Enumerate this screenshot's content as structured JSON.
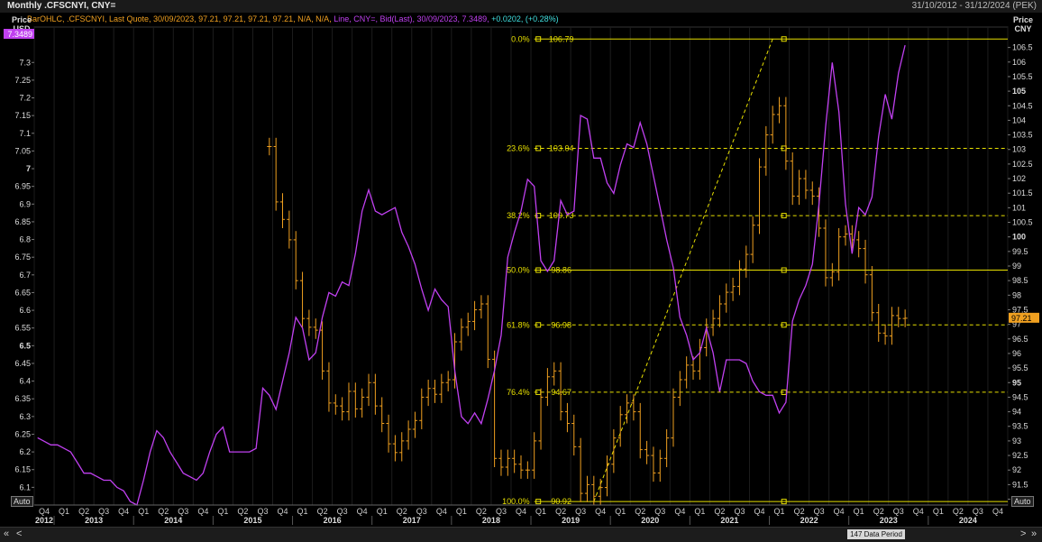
{
  "header": {
    "title": "Monthly .CFSCNYI, CNY=",
    "date_range": "31/10/2012 - 31/12/2024 (PEK)"
  },
  "legend": {
    "bar_series": "BarOHLC, .CFSCNYI, Last Quote, 30/09/2023, 97.21, 97.21, 97.21, 97.21, N/A, N/A,",
    "line_series": "Line, CNY=, Bid(Last), 30/09/2023, 7.3489,",
    "change": "+0.0202, (+0.28%)"
  },
  "left_axis": {
    "title_1": "Price",
    "title_2": "USD",
    "current_value": "7.3489"
  },
  "right_axis": {
    "title_1": "Price",
    "title_2": "CNY",
    "current_value": "97.21"
  },
  "auto_label": "Auto",
  "bottom": {
    "data_period": "147 Data Period",
    "prev_label": "«",
    "scroll_left": "<",
    "scroll_right": ">",
    "next_label": "»"
  },
  "colors": {
    "bars": "#f0a020",
    "line": "#c040f0",
    "fib": "#e8e000",
    "left_badge": "#c040f0",
    "right_badge": "#f0a020"
  },
  "chart_data": {
    "type": "line",
    "x_unit": "month",
    "x_range": [
      "2012-10",
      "2024-12"
    ],
    "left_axis": {
      "ylim": [
        6.05,
        7.4
      ],
      "ticks": [
        "6.1",
        "6.15",
        "6.2",
        "6.25",
        "6.3",
        "6.35",
        "6.4",
        "6.45",
        "6.5",
        "6.55",
        "6.6",
        "6.65",
        "6.7",
        "6.75",
        "6.8",
        "6.85",
        "6.9",
        "6.95",
        "7",
        "7.05",
        "7.1",
        "7.15",
        "7.2",
        "7.25",
        "7.3"
      ],
      "bold_ticks": [
        "6.5",
        "7"
      ]
    },
    "right_axis": {
      "ylim": [
        90.8,
        107.2
      ],
      "ticks": [
        "91",
        "91.5",
        "92",
        "92.5",
        "93",
        "93.5",
        "94",
        "94.5",
        "95",
        "95.5",
        "96",
        "96.5",
        "97",
        "97.5",
        "98",
        "98.5",
        "99",
        "99.5",
        "100",
        "100.5",
        "101",
        "101.5",
        "102",
        "102.5",
        "103",
        "103.5",
        "104",
        "104.5",
        "105",
        "105.5",
        "106",
        "106.5"
      ],
      "bold_ticks": [
        "95",
        "100",
        "105"
      ]
    },
    "x_quarter_labels": [
      "Q4",
      "Q1",
      "Q2",
      "Q3",
      "Q4",
      "Q1",
      "Q2",
      "Q3",
      "Q4",
      "Q1",
      "Q2",
      "Q3",
      "Q4",
      "Q1",
      "Q2",
      "Q3",
      "Q4",
      "Q1",
      "Q2",
      "Q3",
      "Q4",
      "Q1",
      "Q2",
      "Q3",
      "Q4",
      "Q1",
      "Q2",
      "Q3",
      "Q4",
      "Q1",
      "Q2",
      "Q3",
      "Q4",
      "Q1",
      "Q2",
      "Q3",
      "Q4",
      "Q1",
      "Q2",
      "Q3",
      "Q4",
      "Q1",
      "Q2",
      "Q3",
      "Q4",
      "Q1",
      "Q2",
      "Q3",
      "Q4"
    ],
    "x_year_labels": [
      "2012",
      "2013",
      "2014",
      "2015",
      "2016",
      "2017",
      "2018",
      "2019",
      "2020",
      "2021",
      "2022",
      "2023",
      "2024"
    ],
    "series_line": {
      "points": [
        [
          "2012-10",
          6.24
        ],
        [
          "2012-11",
          6.23
        ],
        [
          "2012-12",
          6.22
        ],
        [
          "2013-01",
          6.22
        ],
        [
          "2013-02",
          6.21
        ],
        [
          "2013-03",
          6.2
        ],
        [
          "2013-04",
          6.17
        ],
        [
          "2013-05",
          6.14
        ],
        [
          "2013-06",
          6.14
        ],
        [
          "2013-07",
          6.13
        ],
        [
          "2013-08",
          6.12
        ],
        [
          "2013-09",
          6.12
        ],
        [
          "2013-10",
          6.1
        ],
        [
          "2013-11",
          6.09
        ],
        [
          "2013-12",
          6.06
        ],
        [
          "2014-01",
          6.05
        ],
        [
          "2014-02",
          6.12
        ],
        [
          "2014-03",
          6.2
        ],
        [
          "2014-04",
          6.26
        ],
        [
          "2014-05",
          6.24
        ],
        [
          "2014-06",
          6.2
        ],
        [
          "2014-07",
          6.17
        ],
        [
          "2014-08",
          6.14
        ],
        [
          "2014-09",
          6.13
        ],
        [
          "2014-10",
          6.12
        ],
        [
          "2014-11",
          6.14
        ],
        [
          "2014-12",
          6.2
        ],
        [
          "2015-01",
          6.25
        ],
        [
          "2015-02",
          6.27
        ],
        [
          "2015-03",
          6.2
        ],
        [
          "2015-04",
          6.2
        ],
        [
          "2015-05",
          6.2
        ],
        [
          "2015-06",
          6.2
        ],
        [
          "2015-07",
          6.21
        ],
        [
          "2015-08",
          6.38
        ],
        [
          "2015-09",
          6.36
        ],
        [
          "2015-10",
          6.32
        ],
        [
          "2015-11",
          6.4
        ],
        [
          "2015-12",
          6.48
        ],
        [
          "2016-01",
          6.58
        ],
        [
          "2016-02",
          6.55
        ],
        [
          "2016-03",
          6.46
        ],
        [
          "2016-04",
          6.48
        ],
        [
          "2016-05",
          6.58
        ],
        [
          "2016-06",
          6.65
        ],
        [
          "2016-07",
          6.64
        ],
        [
          "2016-08",
          6.68
        ],
        [
          "2016-09",
          6.67
        ],
        [
          "2016-10",
          6.76
        ],
        [
          "2016-11",
          6.88
        ],
        [
          "2016-12",
          6.94
        ],
        [
          "2017-01",
          6.88
        ],
        [
          "2017-02",
          6.87
        ],
        [
          "2017-03",
          6.88
        ],
        [
          "2017-04",
          6.89
        ],
        [
          "2017-05",
          6.82
        ],
        [
          "2017-06",
          6.78
        ],
        [
          "2017-07",
          6.73
        ],
        [
          "2017-08",
          6.66
        ],
        [
          "2017-09",
          6.6
        ],
        [
          "2017-10",
          6.66
        ],
        [
          "2017-11",
          6.63
        ],
        [
          "2017-12",
          6.61
        ],
        [
          "2018-01",
          6.43
        ],
        [
          "2018-02",
          6.3
        ],
        [
          "2018-03",
          6.28
        ],
        [
          "2018-04",
          6.31
        ],
        [
          "2018-05",
          6.28
        ],
        [
          "2018-06",
          6.35
        ],
        [
          "2018-07",
          6.43
        ],
        [
          "2018-08",
          6.53
        ],
        [
          "2018-09",
          6.75
        ],
        [
          "2018-10",
          6.82
        ],
        [
          "2018-11",
          6.88
        ],
        [
          "2018-12",
          6.97
        ],
        [
          "2019-01",
          6.95
        ],
        [
          "2019-02",
          6.74
        ],
        [
          "2019-03",
          6.71
        ],
        [
          "2019-04",
          6.74
        ],
        [
          "2019-05",
          6.91
        ],
        [
          "2019-06",
          6.87
        ],
        [
          "2019-07",
          6.88
        ],
        [
          "2019-08",
          7.15
        ],
        [
          "2019-09",
          7.14
        ],
        [
          "2019-10",
          7.03
        ],
        [
          "2019-11",
          7.03
        ],
        [
          "2019-12",
          6.96
        ],
        [
          "2020-01",
          6.93
        ],
        [
          "2020-02",
          7.01
        ],
        [
          "2020-03",
          7.07
        ],
        [
          "2020-04",
          7.06
        ],
        [
          "2020-05",
          7.13
        ],
        [
          "2020-06",
          7.07
        ],
        [
          "2020-07",
          6.98
        ],
        [
          "2020-08",
          6.89
        ],
        [
          "2020-09",
          6.8
        ],
        [
          "2020-10",
          6.72
        ],
        [
          "2020-11",
          6.58
        ],
        [
          "2020-12",
          6.53
        ],
        [
          "2021-01",
          6.46
        ],
        [
          "2021-02",
          6.48
        ],
        [
          "2021-03",
          6.55
        ],
        [
          "2021-04",
          6.48
        ],
        [
          "2021-05",
          6.37
        ],
        [
          "2021-06",
          6.46
        ],
        [
          "2021-07",
          6.46
        ],
        [
          "2021-08",
          6.46
        ],
        [
          "2021-09",
          6.45
        ],
        [
          "2021-10",
          6.4
        ],
        [
          "2021-11",
          6.37
        ],
        [
          "2021-12",
          6.36
        ],
        [
          "2022-01",
          6.36
        ],
        [
          "2022-02",
          6.31
        ],
        [
          "2022-03",
          6.34
        ],
        [
          "2022-04",
          6.57
        ],
        [
          "2022-05",
          6.63
        ],
        [
          "2022-06",
          6.67
        ],
        [
          "2022-07",
          6.73
        ],
        [
          "2022-08",
          6.9
        ],
        [
          "2022-09",
          7.12
        ],
        [
          "2022-10",
          7.3
        ],
        [
          "2022-11",
          7.16
        ],
        [
          "2022-12",
          6.9
        ],
        [
          "2023-01",
          6.76
        ],
        [
          "2023-02",
          6.89
        ],
        [
          "2023-03",
          6.87
        ],
        [
          "2023-04",
          6.92
        ],
        [
          "2023-05",
          7.09
        ],
        [
          "2023-06",
          7.21
        ],
        [
          "2023-07",
          7.14
        ],
        [
          "2023-08",
          7.27
        ],
        [
          "2023-09",
          7.3489
        ]
      ]
    },
    "series_bars": {
      "ohlc_close": [
        [
          "2015-09",
          103.1
        ],
        [
          "2015-10",
          101.2
        ],
        [
          "2015-11",
          100.6
        ],
        [
          "2015-12",
          99.9
        ],
        [
          "2016-01",
          98.5
        ],
        [
          "2016-02",
          97.2
        ],
        [
          "2016-03",
          96.9
        ],
        [
          "2016-04",
          96.8
        ],
        [
          "2016-05",
          95.4
        ],
        [
          "2016-06",
          94.3
        ],
        [
          "2016-07",
          94.2
        ],
        [
          "2016-08",
          94.0
        ],
        [
          "2016-09",
          94.7
        ],
        [
          "2016-10",
          94.1
        ],
        [
          "2016-11",
          94.5
        ],
        [
          "2016-12",
          95.0
        ],
        [
          "2017-01",
          94.2
        ],
        [
          "2017-02",
          93.6
        ],
        [
          "2017-03",
          92.9
        ],
        [
          "2017-04",
          92.6
        ],
        [
          "2017-05",
          93.0
        ],
        [
          "2017-06",
          93.4
        ],
        [
          "2017-07",
          93.7
        ],
        [
          "2017-08",
          94.5
        ],
        [
          "2017-09",
          94.8
        ],
        [
          "2017-10",
          94.6
        ],
        [
          "2017-11",
          95.0
        ],
        [
          "2017-12",
          95.1
        ],
        [
          "2018-01",
          96.4
        ],
        [
          "2018-02",
          96.9
        ],
        [
          "2018-03",
          97.1
        ],
        [
          "2018-04",
          97.5
        ],
        [
          "2018-05",
          97.7
        ],
        [
          "2018-06",
          95.8
        ],
        [
          "2018-07",
          92.4
        ],
        [
          "2018-08",
          92.1
        ],
        [
          "2018-09",
          92.4
        ],
        [
          "2018-10",
          92.2
        ],
        [
          "2018-11",
          92.0
        ],
        [
          "2018-12",
          92.0
        ],
        [
          "2019-01",
          93.0
        ],
        [
          "2019-02",
          94.5
        ],
        [
          "2019-03",
          95.2
        ],
        [
          "2019-04",
          95.4
        ],
        [
          "2019-05",
          94.0
        ],
        [
          "2019-06",
          93.6
        ],
        [
          "2019-07",
          92.8
        ],
        [
          "2019-08",
          91.2
        ],
        [
          "2019-09",
          91.5
        ],
        [
          "2019-10",
          91.1
        ],
        [
          "2019-11",
          91.4
        ],
        [
          "2019-12",
          92.2
        ],
        [
          "2020-01",
          93.1
        ],
        [
          "2020-02",
          93.9
        ],
        [
          "2020-03",
          94.3
        ],
        [
          "2020-04",
          94.0
        ],
        [
          "2020-05",
          92.7
        ],
        [
          "2020-06",
          92.5
        ],
        [
          "2020-07",
          91.9
        ],
        [
          "2020-08",
          92.4
        ],
        [
          "2020-09",
          93.1
        ],
        [
          "2020-10",
          94.5
        ],
        [
          "2020-11",
          95.1
        ],
        [
          "2020-12",
          95.6
        ],
        [
          "2021-01",
          95.4
        ],
        [
          "2021-02",
          96.2
        ],
        [
          "2021-03",
          96.9
        ],
        [
          "2021-04",
          97.2
        ],
        [
          "2021-05",
          97.7
        ],
        [
          "2021-06",
          98.1
        ],
        [
          "2021-07",
          98.3
        ],
        [
          "2021-08",
          98.9
        ],
        [
          "2021-09",
          99.4
        ],
        [
          "2021-10",
          100.4
        ],
        [
          "2021-11",
          102.4
        ],
        [
          "2021-12",
          103.5
        ],
        [
          "2022-01",
          104.2
        ],
        [
          "2022-02",
          104.5
        ],
        [
          "2022-03",
          102.6
        ],
        [
          "2022-04",
          101.4
        ],
        [
          "2022-05",
          102.0
        ],
        [
          "2022-06",
          101.6
        ],
        [
          "2022-07",
          101.4
        ],
        [
          "2022-08",
          100.3
        ],
        [
          "2022-09",
          98.6
        ],
        [
          "2022-10",
          98.8
        ],
        [
          "2022-11",
          100.0
        ],
        [
          "2022-12",
          100.1
        ],
        [
          "2023-01",
          99.9
        ],
        [
          "2023-02",
          99.6
        ],
        [
          "2023-03",
          98.7
        ],
        [
          "2023-04",
          97.4
        ],
        [
          "2023-05",
          96.7
        ],
        [
          "2023-06",
          96.6
        ],
        [
          "2023-07",
          97.3
        ],
        [
          "2023-08",
          97.2
        ],
        [
          "2023-09",
          97.21
        ]
      ]
    },
    "fib_levels": [
      {
        "label": "0.0%",
        "value": 106.79
      },
      {
        "label": "23.6%",
        "value": 103.04
      },
      {
        "label": "38.2%",
        "value": 100.73
      },
      {
        "label": "50.0%",
        "value": 98.86
      },
      {
        "label": "61.8%",
        "value": 96.98
      },
      {
        "label": "76.4%",
        "value": 94.67
      },
      {
        "label": "100.0%",
        "value": 90.92
      }
    ],
    "fib_labels": [
      "0.0%",
      "106.79",
      "23.6%",
      "103.04",
      "38.2%",
      "100.73",
      "50.0%",
      "98.86",
      "61.8%",
      "96.98",
      "76.4%",
      "94.67",
      "100.0%",
      "90.92"
    ],
    "trend_line": {
      "from": [
        "2019-10",
        90.92
      ],
      "to": [
        "2022-01",
        106.79
      ]
    }
  }
}
